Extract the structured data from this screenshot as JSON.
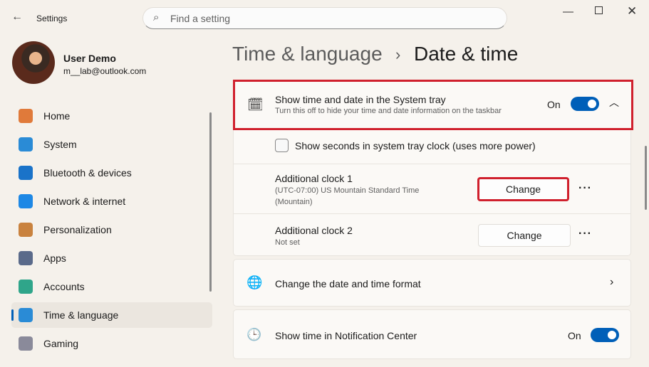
{
  "app": {
    "title": "Settings",
    "search_placeholder": "Find a setting"
  },
  "user": {
    "name": "User Demo",
    "email": "m__lab@outlook.com"
  },
  "nav": [
    {
      "label": "Home",
      "color": "#e07a3a"
    },
    {
      "label": "System",
      "color": "#2a8bd6"
    },
    {
      "label": "Bluetooth & devices",
      "color": "#1a73c9"
    },
    {
      "label": "Network & internet",
      "color": "#1e88e5"
    },
    {
      "label": "Personalization",
      "color": "#c9823e"
    },
    {
      "label": "Apps",
      "color": "#5a6a8a"
    },
    {
      "label": "Accounts",
      "color": "#2fa58a"
    },
    {
      "label": "Time & language",
      "color": "#2a8bd6"
    },
    {
      "label": "Gaming",
      "color": "#8a8a9a"
    }
  ],
  "breadcrumb": {
    "parent": "Time & language",
    "sep": "›",
    "current": "Date & time"
  },
  "tray": {
    "title": "Show time and date in the System tray",
    "desc": "Turn this off to hide your time and date information on the taskbar",
    "state": "On"
  },
  "seconds": {
    "label": "Show seconds in system tray clock (uses more power)"
  },
  "clock1": {
    "title": "Additional clock 1",
    "desc1": "(UTC-07:00) US Mountain Standard Time",
    "desc2": "(Mountain)",
    "button": "Change",
    "more": "···"
  },
  "clock2": {
    "title": "Additional clock 2",
    "desc": "Not set",
    "button": "Change",
    "more": "···"
  },
  "format": {
    "title": "Change the date and time format"
  },
  "notif": {
    "title": "Show time in Notification Center",
    "state": "On"
  }
}
